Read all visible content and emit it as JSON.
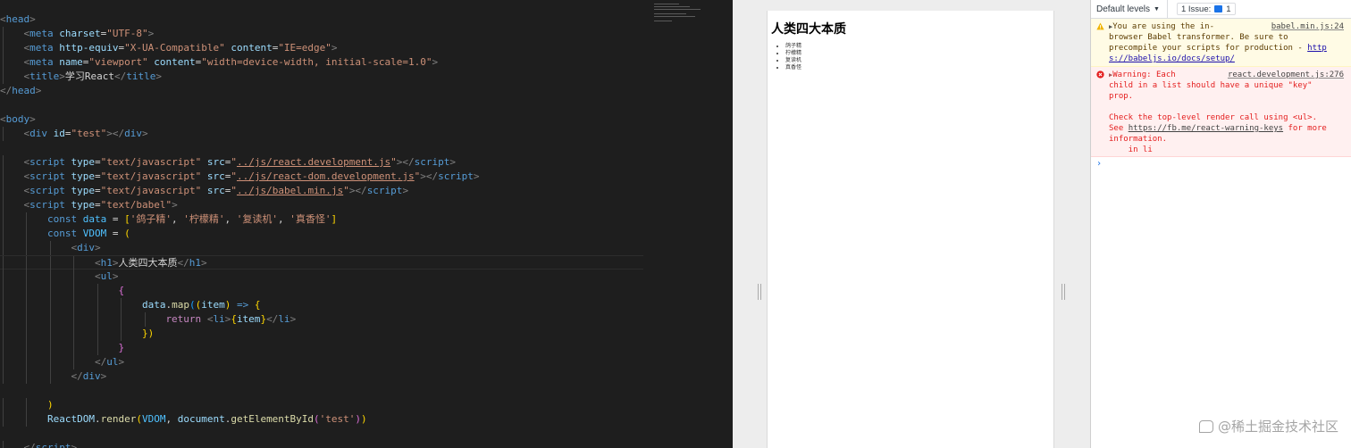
{
  "editor": {
    "lines": [
      [
        [
          "tag",
          "<"
        ],
        [
          "name",
          "head"
        ],
        [
          "tag",
          ">"
        ]
      ],
      [
        [
          "text",
          "    "
        ],
        [
          "tag",
          "<"
        ],
        [
          "name",
          "meta"
        ],
        [
          "text",
          " "
        ],
        [
          "attr",
          "charset"
        ],
        [
          "text",
          "="
        ],
        [
          "str",
          "\"UTF-8\""
        ],
        [
          "tag",
          ">"
        ]
      ],
      [
        [
          "text",
          "    "
        ],
        [
          "tag",
          "<"
        ],
        [
          "name",
          "meta"
        ],
        [
          "text",
          " "
        ],
        [
          "attr",
          "http-equiv"
        ],
        [
          "text",
          "="
        ],
        [
          "str",
          "\"X-UA-Compatible\""
        ],
        [
          "text",
          " "
        ],
        [
          "attr",
          "content"
        ],
        [
          "text",
          "="
        ],
        [
          "str",
          "\"IE=edge\""
        ],
        [
          "tag",
          ">"
        ]
      ],
      [
        [
          "text",
          "    "
        ],
        [
          "tag",
          "<"
        ],
        [
          "name",
          "meta"
        ],
        [
          "text",
          " "
        ],
        [
          "attr",
          "name"
        ],
        [
          "text",
          "="
        ],
        [
          "str",
          "\"viewport\""
        ],
        [
          "text",
          " "
        ],
        [
          "attr",
          "content"
        ],
        [
          "text",
          "="
        ],
        [
          "str",
          "\"width=device-width, initial-scale=1.0\""
        ],
        [
          "tag",
          ">"
        ]
      ],
      [
        [
          "text",
          "    "
        ],
        [
          "tag",
          "<"
        ],
        [
          "name",
          "title"
        ],
        [
          "tag",
          ">"
        ],
        [
          "text",
          "学习React"
        ],
        [
          "tag",
          "</"
        ],
        [
          "name",
          "title"
        ],
        [
          "tag",
          ">"
        ]
      ],
      [
        [
          "tag",
          "</"
        ],
        [
          "name",
          "head"
        ],
        [
          "tag",
          ">"
        ]
      ],
      [],
      [
        [
          "tag",
          "<"
        ],
        [
          "name",
          "body"
        ],
        [
          "tag",
          ">"
        ]
      ],
      [
        [
          "text",
          "    "
        ],
        [
          "tag",
          "<"
        ],
        [
          "name",
          "div"
        ],
        [
          "text",
          " "
        ],
        [
          "attr",
          "id"
        ],
        [
          "text",
          "="
        ],
        [
          "str",
          "\"test\""
        ],
        [
          "tag",
          "></"
        ],
        [
          "name",
          "div"
        ],
        [
          "tag",
          ">"
        ]
      ],
      [],
      [
        [
          "text",
          "    "
        ],
        [
          "tag",
          "<"
        ],
        [
          "name",
          "script"
        ],
        [
          "text",
          " "
        ],
        [
          "attr",
          "type"
        ],
        [
          "text",
          "="
        ],
        [
          "str",
          "\"text/javascript\""
        ],
        [
          "text",
          " "
        ],
        [
          "attr",
          "src"
        ],
        [
          "text",
          "="
        ],
        [
          "str",
          "\""
        ],
        [
          "str-u",
          "../js/react.development.js"
        ],
        [
          "str",
          "\""
        ],
        [
          "tag",
          "></"
        ],
        [
          "name",
          "script"
        ],
        [
          "tag",
          ">"
        ]
      ],
      [
        [
          "text",
          "    "
        ],
        [
          "tag",
          "<"
        ],
        [
          "name",
          "script"
        ],
        [
          "text",
          " "
        ],
        [
          "attr",
          "type"
        ],
        [
          "text",
          "="
        ],
        [
          "str",
          "\"text/javascript\""
        ],
        [
          "text",
          " "
        ],
        [
          "attr",
          "src"
        ],
        [
          "text",
          "="
        ],
        [
          "str",
          "\""
        ],
        [
          "str-u",
          "../js/react-dom.development.js"
        ],
        [
          "str",
          "\""
        ],
        [
          "tag",
          "></"
        ],
        [
          "name",
          "script"
        ],
        [
          "tag",
          ">"
        ]
      ],
      [
        [
          "text",
          "    "
        ],
        [
          "tag",
          "<"
        ],
        [
          "name",
          "script"
        ],
        [
          "text",
          " "
        ],
        [
          "attr",
          "type"
        ],
        [
          "text",
          "="
        ],
        [
          "str",
          "\"text/javascript\""
        ],
        [
          "text",
          " "
        ],
        [
          "attr",
          "src"
        ],
        [
          "text",
          "="
        ],
        [
          "str",
          "\""
        ],
        [
          "str-u",
          "../js/babel.min.js"
        ],
        [
          "str",
          "\""
        ],
        [
          "tag",
          "></"
        ],
        [
          "name",
          "script"
        ],
        [
          "tag",
          ">"
        ]
      ],
      [
        [
          "text",
          "    "
        ],
        [
          "tag",
          "<"
        ],
        [
          "name",
          "script"
        ],
        [
          "text",
          " "
        ],
        [
          "attr",
          "type"
        ],
        [
          "text",
          "="
        ],
        [
          "str",
          "\"text/babel\""
        ],
        [
          "tag",
          ">"
        ]
      ],
      [
        [
          "text",
          "        "
        ],
        [
          "kw",
          "const"
        ],
        [
          "text",
          " "
        ],
        [
          "var",
          "data"
        ],
        [
          "text",
          " = "
        ],
        [
          "b1",
          "["
        ],
        [
          "str",
          "'鸽子精'"
        ],
        [
          "text",
          ", "
        ],
        [
          "str",
          "'柠檬精'"
        ],
        [
          "text",
          ", "
        ],
        [
          "str",
          "'复读机'"
        ],
        [
          "text",
          ", "
        ],
        [
          "str",
          "'真香怪'"
        ],
        [
          "b1",
          "]"
        ]
      ],
      [
        [
          "text",
          "        "
        ],
        [
          "kw",
          "const"
        ],
        [
          "text",
          " "
        ],
        [
          "var",
          "VDOM"
        ],
        [
          "text",
          " = "
        ],
        [
          "b1",
          "("
        ]
      ],
      [
        [
          "text",
          "            "
        ],
        [
          "tag",
          "<"
        ],
        [
          "name",
          "div"
        ],
        [
          "tag",
          ">"
        ]
      ],
      [
        [
          "text",
          "                "
        ],
        [
          "tag",
          "<"
        ],
        [
          "name",
          "h1"
        ],
        [
          "tag",
          ">"
        ],
        [
          "text",
          "人类四大本质"
        ],
        [
          "tag",
          "</"
        ],
        [
          "name",
          "h1"
        ],
        [
          "tag",
          ">"
        ]
      ],
      [
        [
          "text",
          "                "
        ],
        [
          "tag",
          "<"
        ],
        [
          "name",
          "ul"
        ],
        [
          "tag",
          ">"
        ]
      ],
      [
        [
          "text",
          "                    "
        ],
        [
          "b2",
          "{"
        ]
      ],
      [
        [
          "text",
          "                        "
        ],
        [
          "param",
          "data"
        ],
        [
          "text",
          "."
        ],
        [
          "fn",
          "map"
        ],
        [
          "b3",
          "("
        ],
        [
          "b1",
          "("
        ],
        [
          "param",
          "item"
        ],
        [
          "b1",
          ")"
        ],
        [
          "text",
          " "
        ],
        [
          "kw",
          "=>"
        ],
        [
          "text",
          " "
        ],
        [
          "b1",
          "{"
        ]
      ],
      [
        [
          "text",
          "                            "
        ],
        [
          "ret",
          "return"
        ],
        [
          "text",
          " "
        ],
        [
          "tag",
          "<"
        ],
        [
          "name",
          "li"
        ],
        [
          "tag",
          ">"
        ],
        [
          "b1",
          "{"
        ],
        [
          "param",
          "item"
        ],
        [
          "b1",
          "}"
        ],
        [
          "tag",
          "</"
        ],
        [
          "name",
          "li"
        ],
        [
          "tag",
          ">"
        ]
      ],
      [
        [
          "text",
          "                        "
        ],
        [
          "b1",
          "})"
        ]
      ],
      [
        [
          "text",
          "                    "
        ],
        [
          "b2",
          "}"
        ]
      ],
      [
        [
          "text",
          "                "
        ],
        [
          "tag",
          "</"
        ],
        [
          "name",
          "ul"
        ],
        [
          "tag",
          ">"
        ]
      ],
      [
        [
          "text",
          "            "
        ],
        [
          "tag",
          "</"
        ],
        [
          "name",
          "div"
        ],
        [
          "tag",
          ">"
        ]
      ],
      [],
      [
        [
          "text",
          "        "
        ],
        [
          "b1",
          ")"
        ]
      ],
      [
        [
          "text",
          "        "
        ],
        [
          "param",
          "ReactDOM"
        ],
        [
          "text",
          "."
        ],
        [
          "fn",
          "render"
        ],
        [
          "b1",
          "("
        ],
        [
          "var",
          "VDOM"
        ],
        [
          "text",
          ", "
        ],
        [
          "param",
          "document"
        ],
        [
          "text",
          "."
        ],
        [
          "fn",
          "getElementById"
        ],
        [
          "b2",
          "("
        ],
        [
          "str",
          "'test'"
        ],
        [
          "b2",
          ")"
        ],
        [
          "b1",
          ")"
        ]
      ],
      [],
      [
        [
          "text",
          "    "
        ],
        [
          "tag",
          "</"
        ],
        [
          "name",
          "script"
        ],
        [
          "tag",
          ">"
        ]
      ]
    ]
  },
  "preview": {
    "heading": "人类四大本质",
    "items": [
      "鸽子精",
      "柠檬精",
      "复读机",
      "真香怪"
    ]
  },
  "devtools": {
    "levels_label": "Default levels",
    "levels_arrow": "▼",
    "issues_label": "1 Issue:",
    "issues_count": "1",
    "warning": {
      "source": "babel.min.js:24",
      "text": "You are using the in-\nbrowser Babel transformer. Be sure to\nprecompile your scripts for production - ",
      "link": "http\ns://babeljs.io/docs/setup/"
    },
    "error": {
      "source": "react.development.js:276",
      "line1": "Warning: Each\nchild in a list should have a unique \"key\"\nprop.\n\nCheck the top-level render call using <ul>.\nSee ",
      "link": "https://fb.me/react-warning-keys",
      "line2": " for more\ninformation.\n    in li"
    },
    "prompt": "›"
  },
  "watermark": "@稀土掘金技术社区",
  "colors": {
    "editor_bg": "#1e1e1e",
    "warning_bg": "#fffbe5",
    "error_bg": "#fff0f0",
    "accent": "#1a73e8"
  }
}
